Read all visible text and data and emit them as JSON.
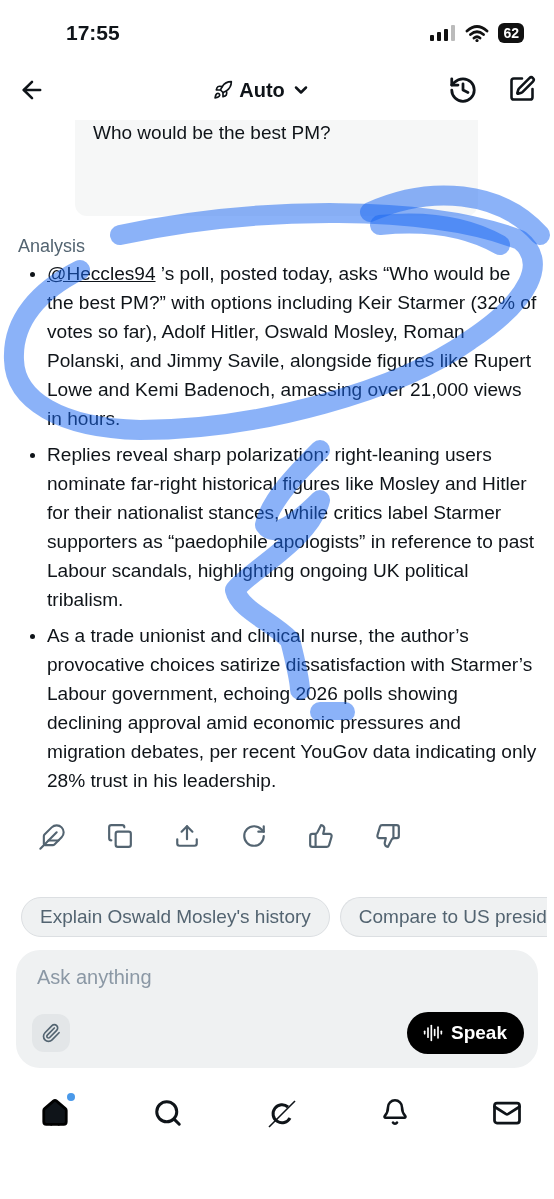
{
  "status_bar": {
    "time": "17:55",
    "battery": "62"
  },
  "header": {
    "mode": "Auto"
  },
  "quoted_post": {
    "text": "Who would be the best PM?"
  },
  "analysis": {
    "label": "Analysis",
    "bullets": [
      {
        "link": "@Heccles94",
        "text": " ’s poll, posted today, asks “Who would be the best PM?” with options including Keir Starmer (32% of votes so far), Adolf Hitler, Oswald Mosley, Roman Polanski, and Jimmy Savile, alongside figures like Rupert Lowe and Kemi Badenoch, amassing over 21,000 views in hours."
      },
      {
        "text": "Replies reveal sharp polarization: right-leaning users nominate far-right historical figures like Mosley and Hitler for their nationalist stances, while critics label Starmer supporters as “paedophile apologists” in reference to past Labour scandals, highlighting ongoing UK political tribalism."
      },
      {
        "text": "As a trade unionist and clinical nurse, the author’s provocative choices satirize dissatisfaction with Starmer’s Labour government, echoing 2026 polls showing declining approval amid economic pressures and migration debates, per recent YouGov data indicating only 28% trust in his leadership."
      }
    ]
  },
  "suggestions": [
    {
      "text": "Explain Oswald Mosley's history",
      "cut": false
    },
    {
      "text": "Compare to US presid",
      "cut": true
    }
  ],
  "composer": {
    "placeholder": "Ask anything",
    "speak_button": "Speak"
  },
  "bottom_nav": [
    {
      "kind": "home",
      "selected": true,
      "unread": true
    },
    {
      "kind": "search",
      "selected": false,
      "unread": false
    },
    {
      "kind": "grok",
      "selected": false,
      "unread": false
    },
    {
      "kind": "bell",
      "selected": false,
      "unread": false
    },
    {
      "kind": "mail",
      "selected": false,
      "unread": false
    }
  ]
}
